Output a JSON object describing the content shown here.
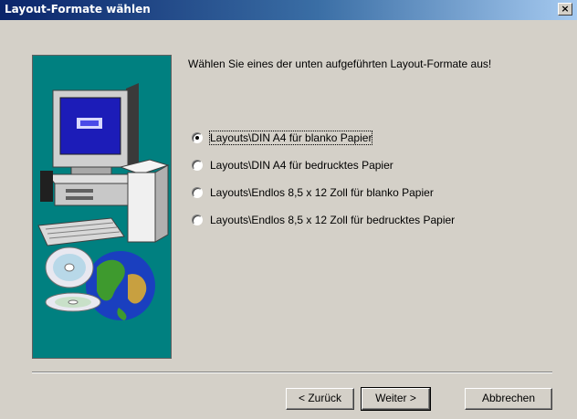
{
  "window": {
    "title": "Layout-Formate wählen",
    "close_label": "×"
  },
  "instruction": "Wählen Sie eines der unten aufgeführten Layout-Formate aus!",
  "options": [
    {
      "label": "Layouts\\DIN A4 für blanko Papier",
      "checked": true
    },
    {
      "label": "Layouts\\DIN A4 für bedrucktes Papier",
      "checked": false
    },
    {
      "label": "Layouts\\Endlos 8,5 x 12 Zoll für blanko Papier",
      "checked": false
    },
    {
      "label": "Layouts\\Endlos 8,5 x 12 Zoll für bedrucktes Papier",
      "checked": false
    }
  ],
  "buttons": {
    "back": "< Zurück",
    "next": "Weiter >",
    "cancel": "Abbrechen"
  },
  "colors": {
    "title_start": "#0a246a",
    "title_end": "#a6caf0",
    "image_bg": "#008080",
    "face": "#d4d0c8"
  },
  "icons": [
    "computer-illustration",
    "cd-icon",
    "globe-icon",
    "close-icon"
  ]
}
